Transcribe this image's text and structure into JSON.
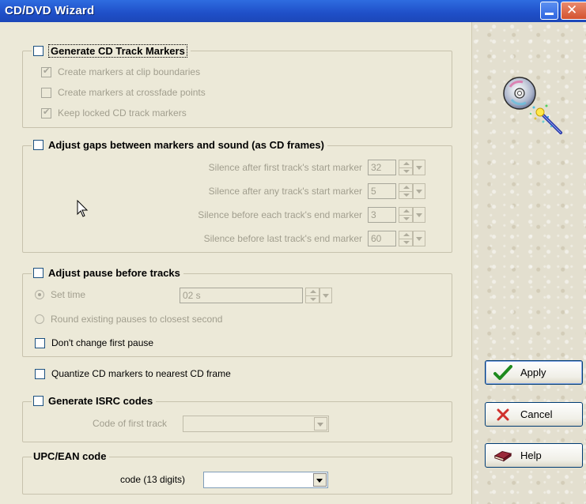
{
  "window": {
    "title": "CD/DVD Wizard"
  },
  "cd_markers": {
    "label": "Generate CD Track Markers",
    "checked": false,
    "options": [
      {
        "label": "Create markers at clip boundaries",
        "checked": true
      },
      {
        "label": "Create markers at crossfade points",
        "checked": false
      },
      {
        "label": "Keep locked CD track markers",
        "checked": true
      }
    ]
  },
  "gaps": {
    "label": "Adjust gaps between markers and sound (as CD frames)",
    "checked": false,
    "rows": [
      {
        "label": "Silence after first track's start marker",
        "value": "32"
      },
      {
        "label": "Silence after any track's start marker",
        "value": "5"
      },
      {
        "label": "Silence before each track's end marker",
        "value": "3"
      },
      {
        "label": "Silence before last track's end marker",
        "value": "60"
      }
    ]
  },
  "pause": {
    "label": "Adjust pause before tracks",
    "checked": false,
    "set_time_label": "Set time",
    "set_time_value": "02 s",
    "round_label": "Round existing pauses to closest second",
    "dont_change_label": "Don't change first pause",
    "dont_change_checked": false
  },
  "quantize": {
    "label": "Quantize CD markers to nearest CD frame",
    "checked": false
  },
  "isrc": {
    "label": "Generate ISRC codes",
    "checked": false,
    "first_track_label": "Code of first track",
    "first_track_value": ""
  },
  "upc": {
    "label": "UPC/EAN code",
    "code_label": "code (13 digits)",
    "code_value": ""
  },
  "buttons": {
    "apply": "Apply",
    "cancel": "Cancel",
    "help": "Help"
  },
  "icons": {
    "title_minimize": "minimize-icon",
    "title_close": "close-icon",
    "logo": "cd-wand-icon",
    "apply": "checkmark-icon",
    "cancel": "x-icon",
    "help": "book-icon",
    "cursor": "mouse-pointer-icon"
  },
  "colors": {
    "title_bar": "#245edb",
    "apply_check": "#1d8a1d",
    "cancel_x": "#d0312d"
  }
}
